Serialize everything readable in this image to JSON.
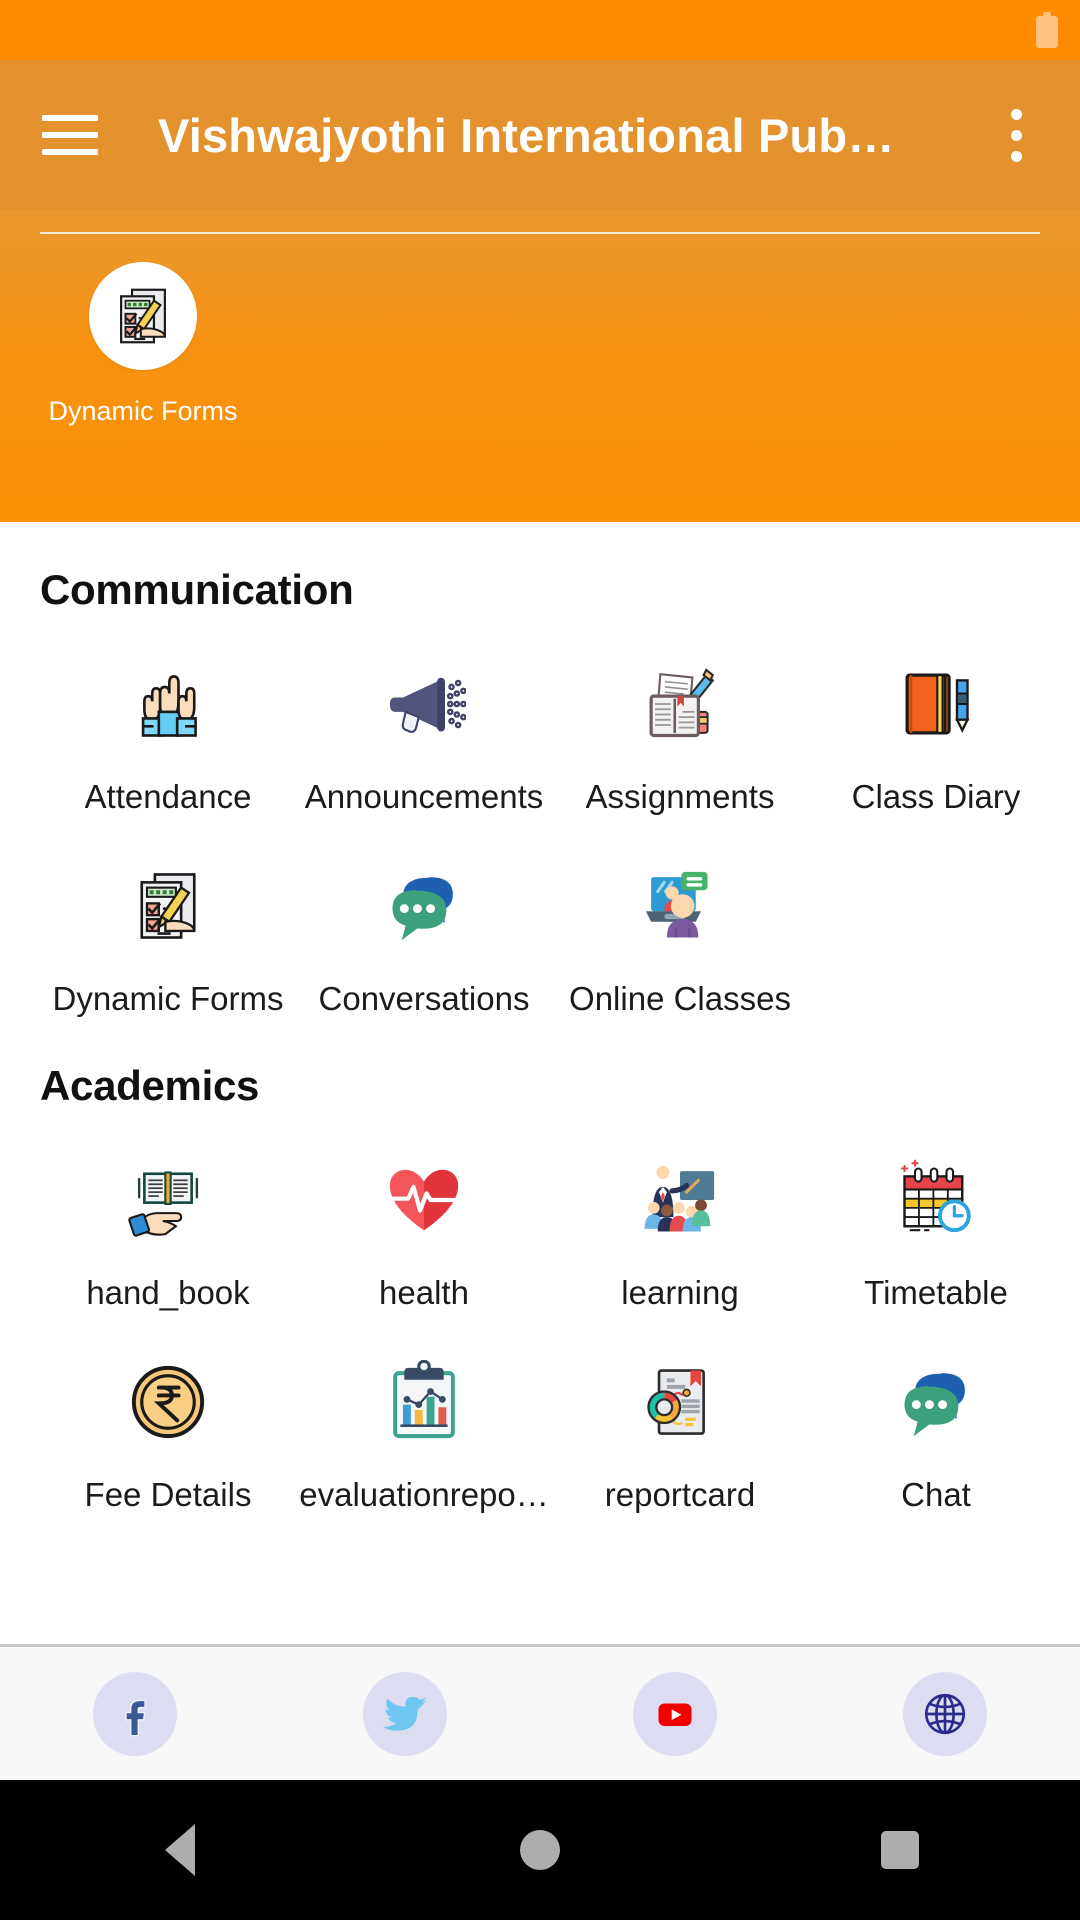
{
  "statusbar": {
    "battery_icon": "battery-icon"
  },
  "appbar": {
    "menu_icon": "hamburger-menu-icon",
    "title": "Vishwajyothi International Pub…",
    "overflow_icon": "overflow-menu-icon"
  },
  "banner": {
    "featured": {
      "label": "Dynamic Forms",
      "icon": "dynamic-forms-icon"
    }
  },
  "sections": [
    {
      "title": "Communication",
      "items": [
        {
          "label": "Attendance",
          "icon": "raised-hands-icon"
        },
        {
          "label": "Announcements",
          "icon": "megaphone-icon"
        },
        {
          "label": "Assignments",
          "icon": "open-book-pencil-icon"
        },
        {
          "label": "Class Diary",
          "icon": "notebook-pencil-icon"
        },
        {
          "label": "Dynamic Forms",
          "icon": "dynamic-forms-icon"
        },
        {
          "label": "Conversations",
          "icon": "speech-bubbles-icon"
        },
        {
          "label": "Online Classes",
          "icon": "laptop-person-icon"
        }
      ]
    },
    {
      "title": "Academics",
      "items": [
        {
          "label": "hand_book",
          "icon": "book-on-hand-icon"
        },
        {
          "label": "health",
          "icon": "heart-pulse-icon"
        },
        {
          "label": "learning",
          "icon": "teacher-classroom-icon"
        },
        {
          "label": "Timetable",
          "icon": "calendar-clock-icon"
        },
        {
          "label": "Fee Details",
          "icon": "rupee-coin-icon"
        },
        {
          "label": "evaluationrepo…",
          "icon": "clipboard-chart-icon"
        },
        {
          "label": "reportcard",
          "icon": "document-donut-chart-icon"
        },
        {
          "label": "Chat",
          "icon": "speech-bubbles-icon"
        }
      ]
    }
  ],
  "social": [
    {
      "name": "facebook",
      "icon": "facebook-icon"
    },
    {
      "name": "twitter",
      "icon": "twitter-icon"
    },
    {
      "name": "youtube",
      "icon": "youtube-icon"
    },
    {
      "name": "website",
      "icon": "globe-icon"
    }
  ],
  "navbar": [
    {
      "name": "back",
      "icon": "back-triangle-icon"
    },
    {
      "name": "home",
      "icon": "home-circle-icon"
    },
    {
      "name": "recents",
      "icon": "recents-square-icon"
    }
  ],
  "colors": {
    "status_bar": "#FF8C00",
    "app_bar": "#E3922E",
    "banner_top": "#E8972E",
    "banner_bottom": "#FA9005",
    "content_bg": "#FFFFFF",
    "social_bg": "#F7F7F8",
    "social_circle": "#DCDDF0",
    "nav_bg": "#000000",
    "text_primary": "#1B1B1B"
  }
}
